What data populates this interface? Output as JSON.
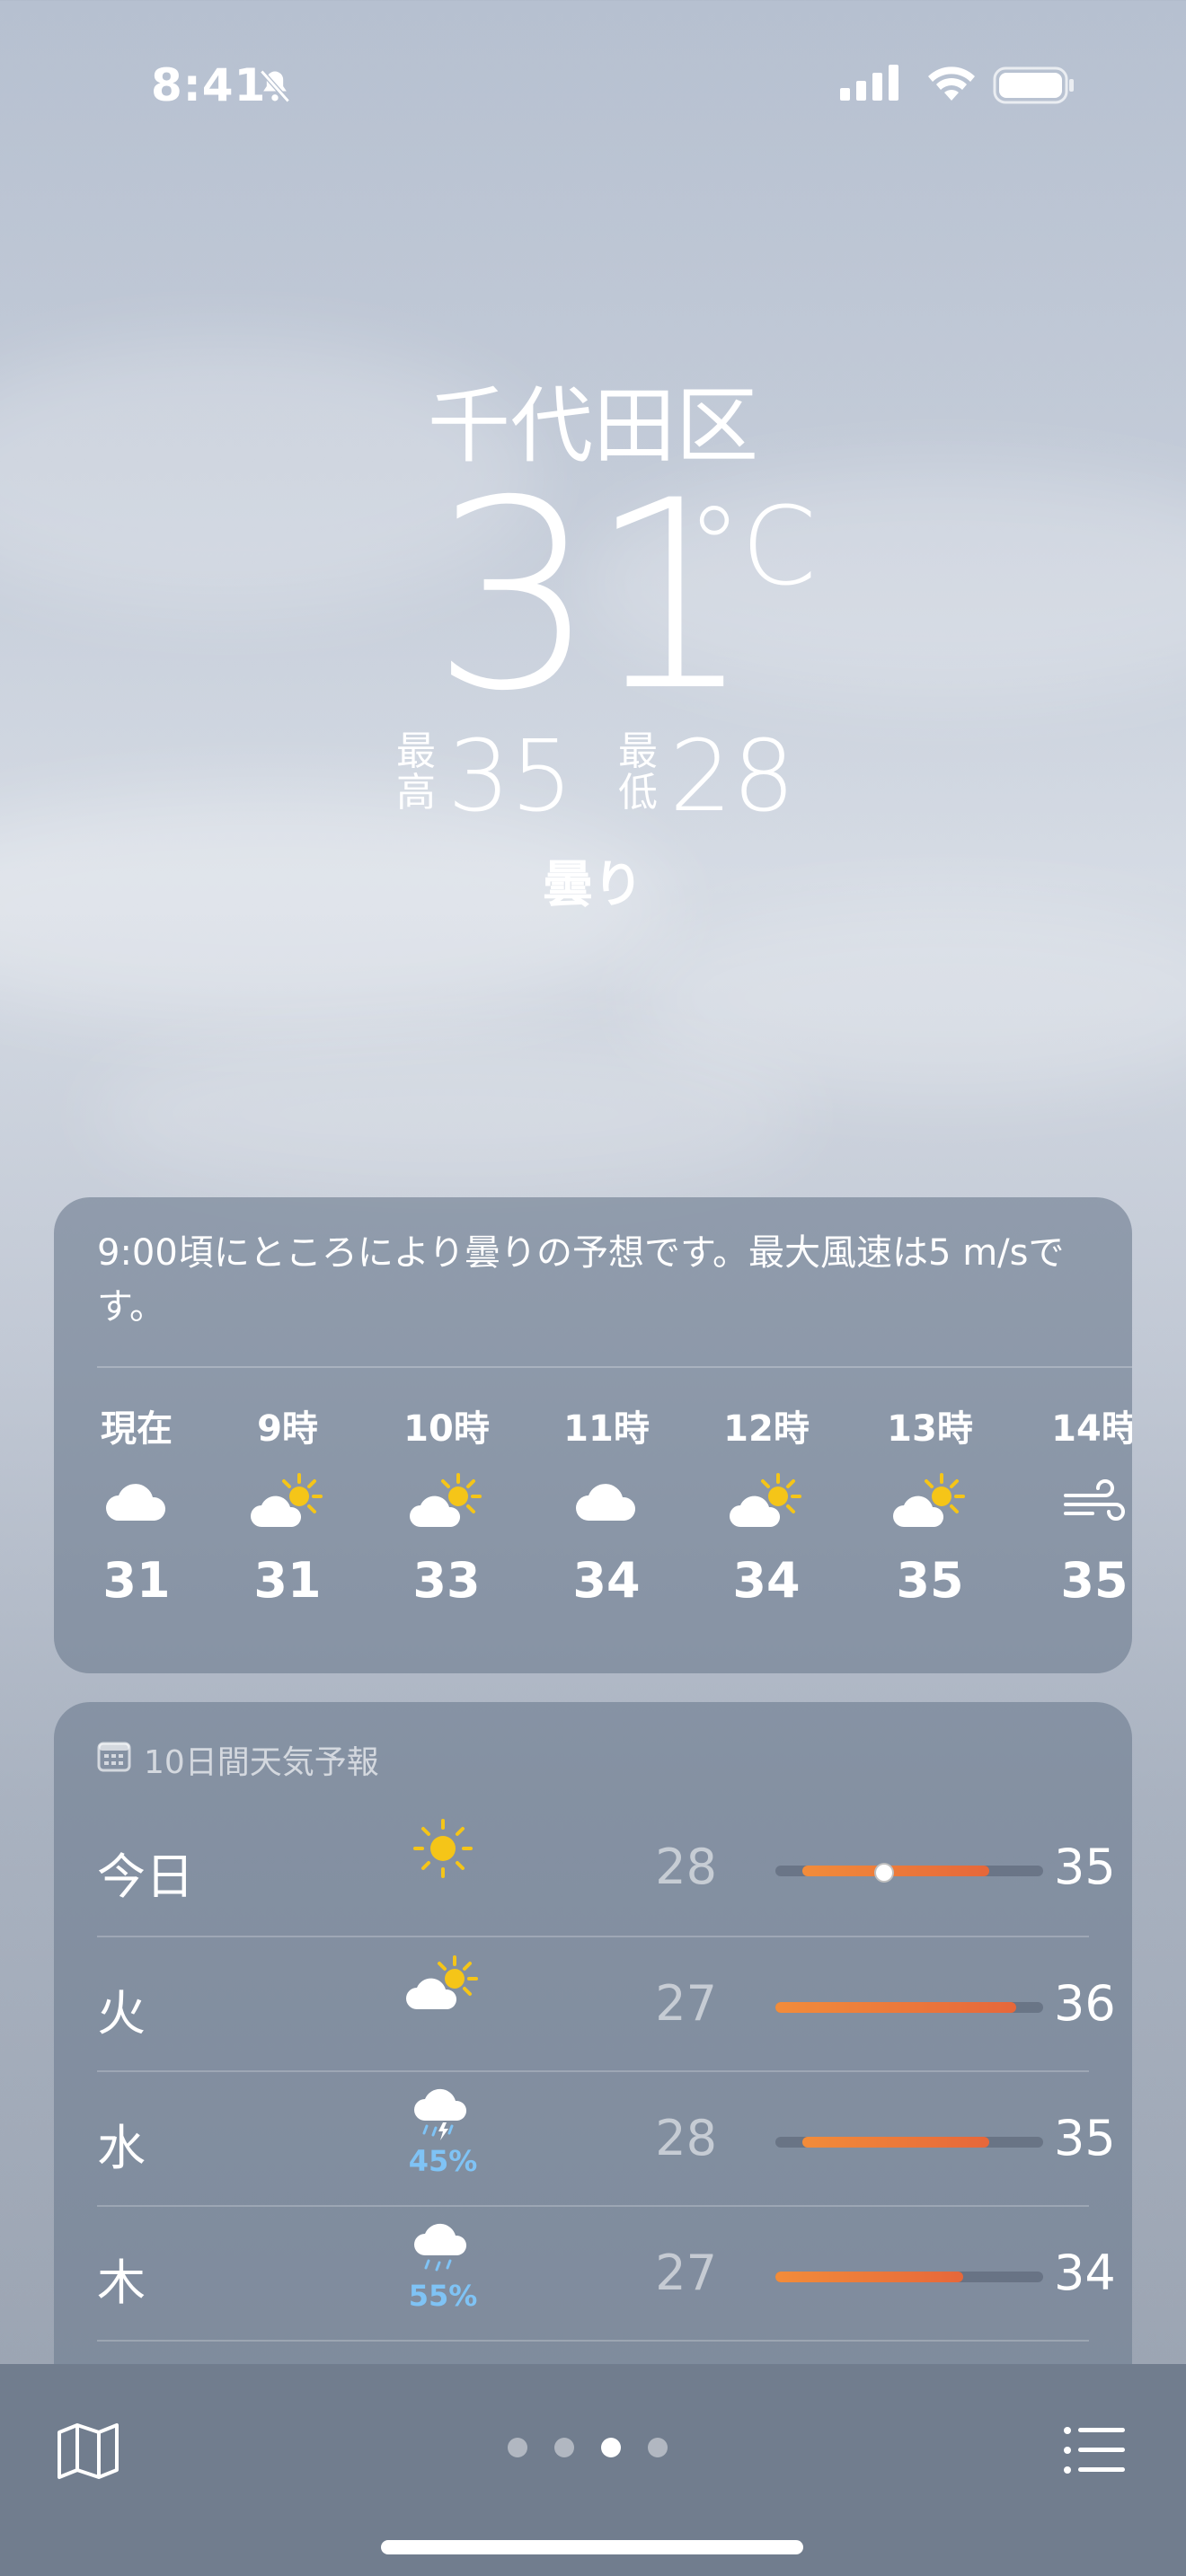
{
  "status_bar": {
    "time": "8:41",
    "icons": [
      "bell-slash-icon",
      "cellular-signal-icon",
      "wifi-icon",
      "battery-icon"
    ]
  },
  "location": {
    "city": "千代田区",
    "temperature": "31",
    "unit": "°C",
    "high_label_1": "最",
    "high_label_2": "高",
    "high": "35",
    "low_label_1": "最",
    "low_label_2": "低",
    "low": "28",
    "condition": "曇り"
  },
  "hourly": {
    "summary": "9:00頃にところにより曇りの予想です。最大風速は5 m/sです。",
    "items": [
      {
        "hour": "現在",
        "icon": "cloud-icon",
        "temp": "31"
      },
      {
        "hour": "9時",
        "icon": "partly-sunny-icon",
        "temp": "31"
      },
      {
        "hour": "10時",
        "icon": "partly-sunny-icon",
        "temp": "33"
      },
      {
        "hour": "11時",
        "icon": "cloud-icon",
        "temp": "34"
      },
      {
        "hour": "12時",
        "icon": "partly-sunny-icon",
        "temp": "34"
      },
      {
        "hour": "13時",
        "icon": "partly-sunny-icon",
        "temp": "35"
      },
      {
        "hour": "14時",
        "icon": "wind-icon",
        "temp": "35"
      }
    ]
  },
  "forecast": {
    "header": "10日間天気予報",
    "header_icon": "calendar-icon",
    "range_min": 27,
    "range_max": 37,
    "current_temp": 31,
    "days": [
      {
        "day": "今日",
        "icon": "sun-icon",
        "precip": "",
        "low": "28",
        "high": "35"
      },
      {
        "day": "火",
        "icon": "partly-sunny-icon",
        "precip": "",
        "low": "27",
        "high": "36"
      },
      {
        "day": "水",
        "icon": "thunderstorm-icon",
        "precip": "45%",
        "low": "28",
        "high": "35"
      },
      {
        "day": "木",
        "icon": "rain-icon",
        "precip": "55%",
        "low": "27",
        "high": "34"
      }
    ]
  },
  "tab_bar": {
    "left_icon": "map-icon",
    "right_icon": "list-icon",
    "pages": 4,
    "active_page": 3
  },
  "colors": {
    "accent_bar": "#e6673a",
    "precip": "#7fc3f5",
    "sun": "#f5c518"
  }
}
